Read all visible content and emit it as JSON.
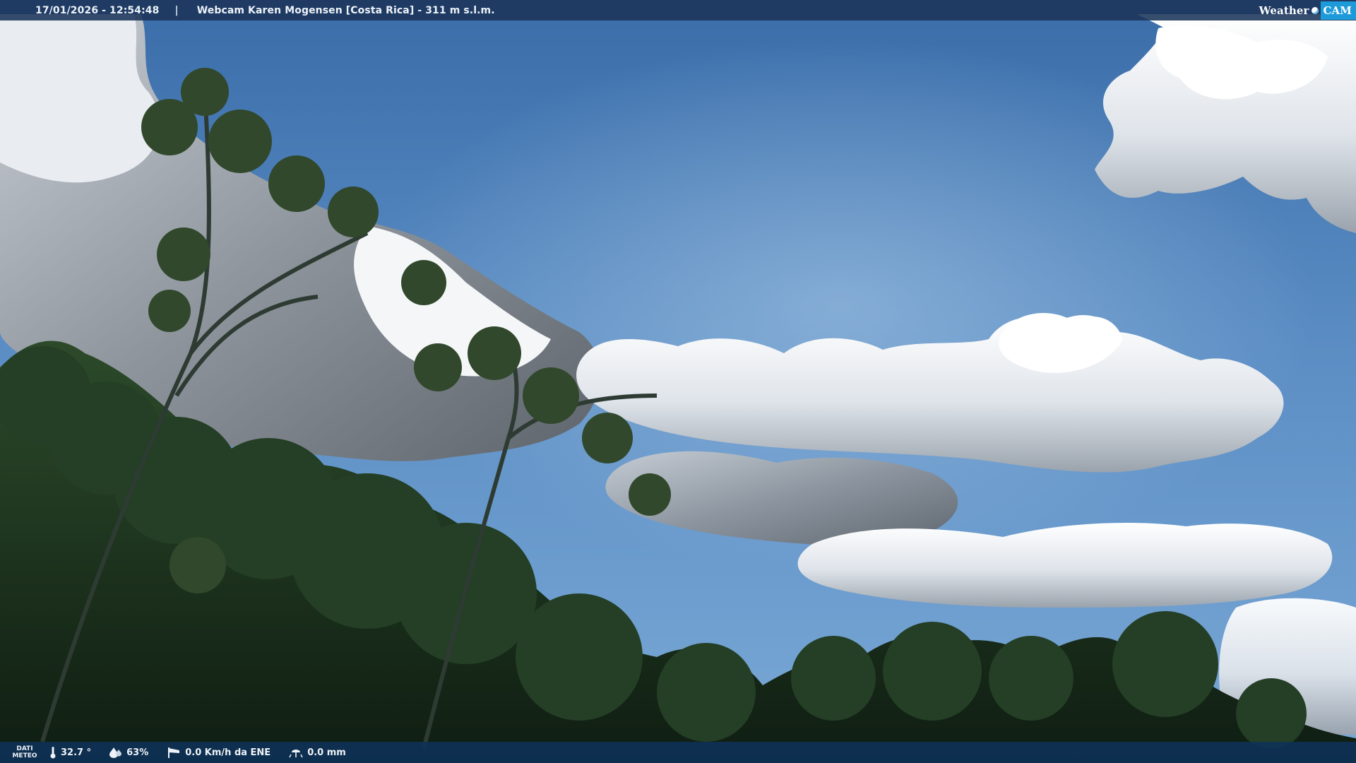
{
  "header": {
    "datetime": "17/01/2026 - 12:54:48",
    "separator": "|",
    "location": "Webcam Karen Mogensen [Costa Rica] - 311 m s.l.m."
  },
  "brand": {
    "word": "Weather",
    "suffix": "CAM"
  },
  "footer": {
    "label_line1": "DATI",
    "label_line2": "METEO",
    "temperature": "32.7 °",
    "humidity": "63%",
    "wind": "0.0 Km/h da ENE",
    "rain": "0.0 mm"
  },
  "icons": {
    "temperature": "thermometer-icon",
    "humidity": "droplet-icon",
    "wind": "wind-sock-icon",
    "rain": "rain-gauge-icon"
  },
  "colors": {
    "sky_top": "#3f72ad",
    "sky_bottom": "#6fa2d2",
    "bar_background": "#1b345a",
    "brand_accent": "#1d9ad9",
    "foliage": "#1c3520"
  }
}
